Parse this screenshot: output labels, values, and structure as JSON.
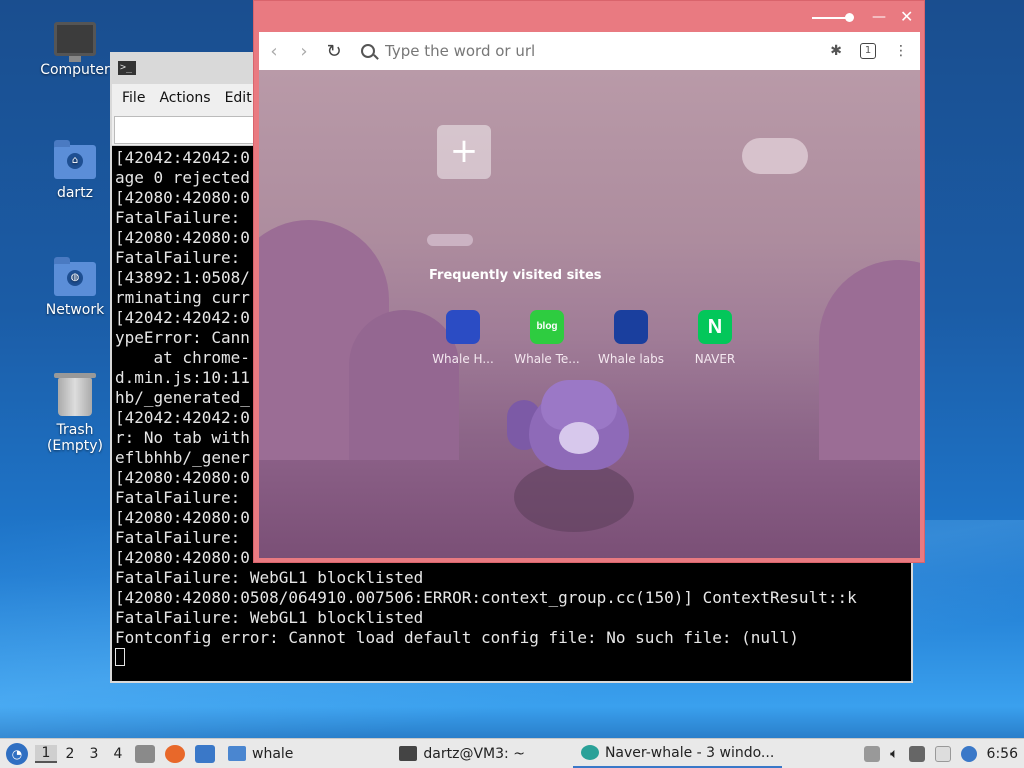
{
  "desktop": {
    "icons": [
      {
        "label": "Computer",
        "icon": "computer-icon"
      },
      {
        "label": "dartz",
        "icon": "home-folder-icon"
      },
      {
        "label": "Network",
        "icon": "network-folder-icon"
      },
      {
        "label": "Trash (Empty)",
        "icon": "trash-icon"
      }
    ]
  },
  "terminal": {
    "menu": [
      "File",
      "Actions",
      "Edit"
    ],
    "lines": [
      "[42042:42042:0",
      "age 0 rejected",
      "[42080:42080:0",
      "FatalFailure:",
      "[42080:42080:0",
      "FatalFailure:",
      "[43892:1:0508/",
      "rminating curr",
      "[42042:42042:0",
      "ypeError: Cann",
      "    at chrome-",
      "d.min.js:10:11",
      "hb/_generated_",
      "[42042:42042:0",
      "r: No tab with",
      "eflbhhb/_gener",
      "[42080:42080:0",
      "FatalFailure:",
      "[42080:42080:0",
      "FatalFailure:",
      "[42080:42080:0",
      "FatalFailure: WebGL1 blocklisted",
      "[42080:42080:0508/064910.007506:ERROR:context_group.cc(150)] ContextResult::k",
      "FatalFailure: WebGL1 blocklisted",
      "Fontconfig error: Cannot load default config file: No such file: (null)"
    ]
  },
  "browser": {
    "address_placeholder": "Type the word or url",
    "tab_count": "1",
    "frequently_visited_title": "Frequently visited sites",
    "sites": [
      {
        "label": "Whale H...",
        "glyph": "",
        "color": "#2b4cc4"
      },
      {
        "label": "Whale Te...",
        "glyph": "blog",
        "color": "#2ecc40"
      },
      {
        "label": "Whale labs",
        "glyph": "",
        "color": "#1a3f9e"
      },
      {
        "label": "NAVER",
        "glyph": "N",
        "color": "#03c75a"
      }
    ]
  },
  "taskbar": {
    "workspaces": [
      "1",
      "2",
      "3",
      "4"
    ],
    "folder_label": "whale",
    "tasks": [
      {
        "label": "dartz@VM3: ~"
      },
      {
        "label": "Naver-whale - 3 windo..."
      }
    ],
    "clock": "6:56"
  },
  "colors": {
    "browser_frame": "#e97a81",
    "taskbar_bg": "#e9e9e9"
  }
}
